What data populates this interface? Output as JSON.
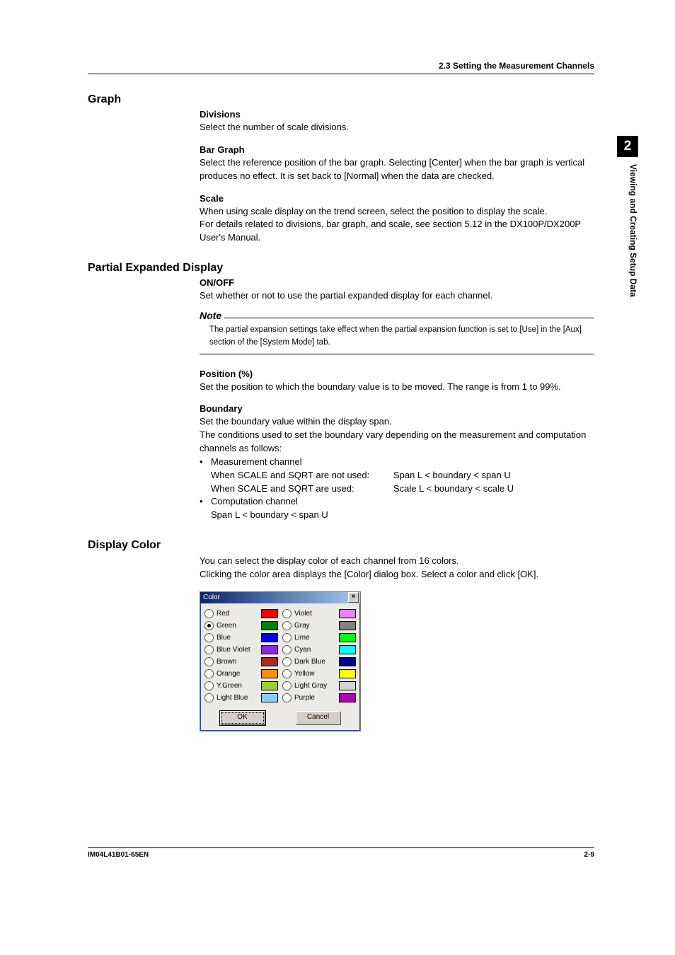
{
  "runningHead": "2.3  Setting the Measurement Channels",
  "sideTab": {
    "num": "2",
    "caption": "Viewing and Creating Setup Data"
  },
  "graph": {
    "heading": "Graph",
    "divisions": {
      "title": "Divisions",
      "text": "Select the number of scale divisions."
    },
    "barGraph": {
      "title": "Bar Graph",
      "text": "Select the reference position of the bar graph. Selecting [Center] when the bar graph is vertical produces no effect. It is set back to [Normal] when the data are checked."
    },
    "scale": {
      "title": "Scale",
      "l1": "When using scale display on the trend screen, select the position to display the scale.",
      "l2": "For details related to divisions, bar graph, and scale, see section 5.12 in the DX100P/DX200P User's Manual."
    }
  },
  "partial": {
    "heading": "Partial Expanded Display",
    "onoff": {
      "title": "ON/OFF",
      "text": "Set whether or not to use the partial expanded display for each channel."
    },
    "noteTitle": "Note",
    "noteText": "The partial expansion settings take effect when the partial expansion function is set to [Use] in the [Aux] section of the [System Mode] tab.",
    "position": {
      "title": "Position (%)",
      "text": "Set the position to which the boundary value is to be moved. The range is from 1 to 99%."
    },
    "boundary": {
      "title": "Boundary",
      "l1": "Set the boundary value within the display span.",
      "l2": "The conditions used to set the boundary vary depending on the measurement and computation channels as follows:",
      "b1": "Measurement channel",
      "b1c1a": "When SCALE and SQRT are not used:",
      "b1c1b": "Span L < boundary < span U",
      "b1c2a": "When SCALE and SQRT are used:",
      "b1c2b": "Scale L < boundary < scale U",
      "b2": "Computation channel",
      "b2c": "Span L < boundary < span U"
    }
  },
  "displayColor": {
    "heading": "Display Color",
    "l1": "You can select the display color of each channel from 16 colors.",
    "l2": "Clicking the color area displays the [Color] dialog box. Select a color and click [OK]."
  },
  "dialog": {
    "title": "Color",
    "close": "×",
    "ok": "OK",
    "cancel": "Cancel",
    "colorsLeft": [
      {
        "name": "Red",
        "hex": "#ff0000",
        "selected": false
      },
      {
        "name": "Green",
        "hex": "#008000",
        "selected": true
      },
      {
        "name": "Blue",
        "hex": "#0000ff",
        "selected": false
      },
      {
        "name": "Blue Violet",
        "hex": "#8a2be2",
        "selected": false
      },
      {
        "name": "Brown",
        "hex": "#a52a2a",
        "selected": false
      },
      {
        "name": "Orange",
        "hex": "#ff8c00",
        "selected": false
      },
      {
        "name": "Y.Green",
        "hex": "#9acd32",
        "selected": false
      },
      {
        "name": "Light Blue",
        "hex": "#87cefa",
        "selected": false
      }
    ],
    "colorsRight": [
      {
        "name": "Violet",
        "hex": "#ee82ee",
        "selected": false
      },
      {
        "name": "Gray",
        "hex": "#808080",
        "selected": false
      },
      {
        "name": "Lime",
        "hex": "#00ff00",
        "selected": false
      },
      {
        "name": "Cyan",
        "hex": "#00ffff",
        "selected": false
      },
      {
        "name": "Dark Blue",
        "hex": "#00008b",
        "selected": false
      },
      {
        "name": "Yellow",
        "hex": "#ffff00",
        "selected": false
      },
      {
        "name": "Light Gray",
        "hex": "#d3d3d3",
        "selected": false
      },
      {
        "name": "Purple",
        "hex": "#b000b0",
        "selected": false
      }
    ]
  },
  "footer": {
    "docId": "IM04L41B01-65EN",
    "pageNo": "2-9"
  }
}
